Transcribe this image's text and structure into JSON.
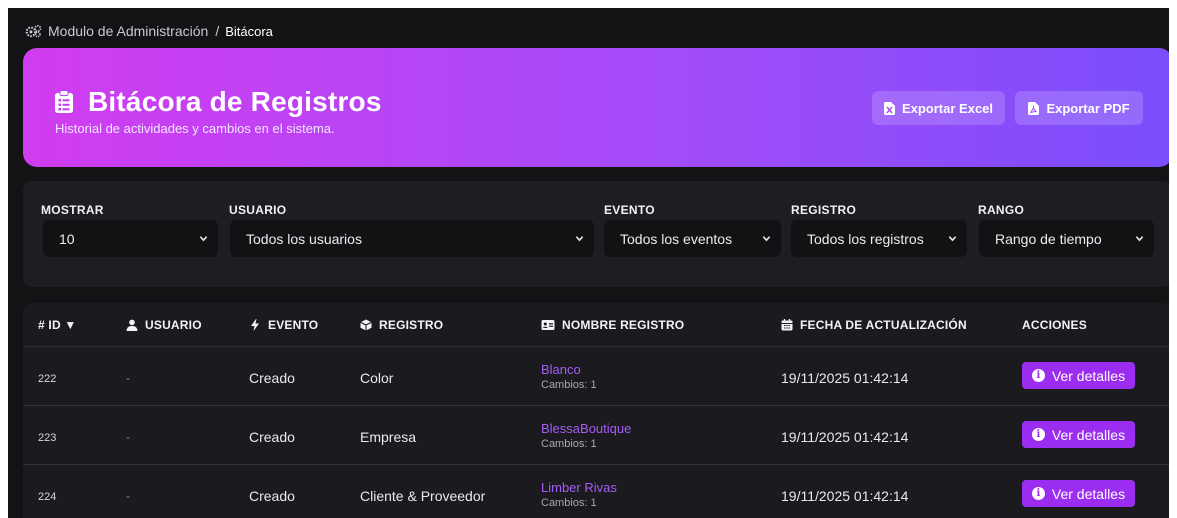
{
  "breadcrumb": {
    "icon": "gears-icon",
    "parent": "Modulo de Administración",
    "separator": "/",
    "current": "Bitácora"
  },
  "hero": {
    "icon": "clipboard-list-icon",
    "title": "Bitácora de Registros",
    "subtitle": "Historial de actividades y cambios en el sistema.",
    "gradient": [
      "#d13cf0",
      "#7b4dfb"
    ],
    "buttons": {
      "excel": {
        "label": "Exportar Excel",
        "icon": "file-excel-icon"
      },
      "pdf": {
        "label": "Exportar PDF",
        "icon": "file-pdf-icon"
      }
    }
  },
  "filters": {
    "mostrar": {
      "label": "MOSTRAR",
      "value": "10"
    },
    "usuario": {
      "label": "USUARIO",
      "value": "Todos los usuarios"
    },
    "evento": {
      "label": "EVENTO",
      "value": "Todos los eventos"
    },
    "registro": {
      "label": "REGISTRO",
      "value": "Todos los registros"
    },
    "rango": {
      "label": "RANGO",
      "value": "Rango de tiempo"
    }
  },
  "table": {
    "headers": {
      "id": "# ID ▼",
      "usuario": "USUARIO",
      "evento": "EVENTO",
      "registro": "REGISTRO",
      "nombre": "NOMBRE REGISTRO",
      "fecha": "FECHA DE ACTUALIZACIÓN",
      "acciones": "ACCIONES"
    },
    "rows": [
      {
        "id": "222",
        "usuario": "-",
        "evento": "Creado",
        "registro": "Color",
        "nombre": "Blanco",
        "cambios": "Cambios: 1",
        "fecha": "19/11/2025 01:42:14",
        "accion": "Ver detalles"
      },
      {
        "id": "223",
        "usuario": "-",
        "evento": "Creado",
        "registro": "Empresa",
        "nombre": "BlessaBoutique",
        "cambios": "Cambios: 1",
        "fecha": "19/11/2025 01:42:14",
        "accion": "Ver detalles"
      },
      {
        "id": "224",
        "usuario": "-",
        "evento": "Creado",
        "registro": "Cliente & Proveedor",
        "nombre": "Limber Rivas",
        "cambios": "Cambios: 1",
        "fecha": "19/11/2025 01:42:14",
        "accion": "Ver detalles"
      }
    ]
  },
  "colors": {
    "accent": "#9a2df0",
    "link": "#a45cf5",
    "background": "#131316"
  }
}
